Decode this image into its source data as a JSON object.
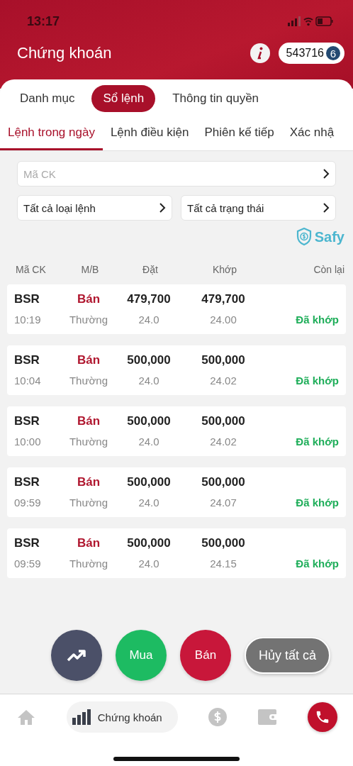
{
  "status_bar": {
    "time": "13:17"
  },
  "header": {
    "title": "Chứng khoán",
    "account": "543716",
    "account_badge": "6"
  },
  "tabs": [
    {
      "label": "Danh mục",
      "selected": false
    },
    {
      "label": "Sổ lệnh",
      "selected": true
    },
    {
      "label": "Thông tin quyền",
      "selected": false
    }
  ],
  "sub_tabs": [
    {
      "label": "Lệnh trong ngày",
      "selected": true
    },
    {
      "label": "Lệnh điều kiện",
      "selected": false
    },
    {
      "label": "Phiên kế tiếp",
      "selected": false
    },
    {
      "label": "Xác nhậ",
      "selected": false
    }
  ],
  "filters": {
    "symbol_placeholder": "Mã CK",
    "order_type": "Tất cả loại lệnh",
    "status": "Tất cả trạng thái"
  },
  "safy_label": "Safy",
  "table": {
    "columns": [
      "Mã CK",
      "M/B",
      "Đặt",
      "Khớp",
      "Còn lại"
    ],
    "rows": [
      {
        "kind": "sell",
        "symbol": "BSR",
        "time": "10:19",
        "side": "Bán",
        "type": "Thường",
        "order_qty": "479,700",
        "order_price": "24.0",
        "match_qty": "479,700",
        "match_price": "24.00",
        "status": "Đã khớp",
        "color": "#1fae5a"
      },
      {
        "kind": "sell",
        "symbol": "BSR",
        "time": "10:04",
        "side": "Bán",
        "type": "Thường",
        "order_qty": "500,000",
        "order_price": "24.0",
        "match_qty": "500,000",
        "match_price": "24.02",
        "status": "Đã khớp",
        "color": "#1fae5a"
      },
      {
        "kind": "sell",
        "symbol": "BSR",
        "time": "10:00",
        "side": "Bán",
        "type": "Thường",
        "order_qty": "500,000",
        "order_price": "24.0",
        "match_qty": "500,000",
        "match_price": "24.02",
        "status": "Đã khớp",
        "color": "#1fae5a"
      },
      {
        "kind": "sell",
        "symbol": "BSR",
        "time": "09:59",
        "side": "Bán",
        "type": "Thường",
        "order_qty": "500,000",
        "order_price": "24.0",
        "match_qty": "500,000",
        "match_price": "24.07",
        "status": "Đã khớp",
        "color": "#1fae5a"
      },
      {
        "kind": "sell",
        "symbol": "BSR",
        "time": "09:59",
        "side": "Bán",
        "type": "Thường",
        "order_qty": "500,000",
        "order_price": "24.0",
        "match_qty": "500,000",
        "match_price": "24.15",
        "status": "Đã khớp",
        "color": "#1fae5a"
      }
    ]
  },
  "actions": [
    {
      "kind": "chart"
    },
    {
      "kind": "buy",
      "label": "Mua"
    },
    {
      "kind": "sell",
      "label": "Bán"
    },
    {
      "kind": "cancel",
      "label": "Hủy tất cả"
    }
  ],
  "bottom_nav": [
    {
      "kind": "home",
      "selected": false
    },
    {
      "kind": "market",
      "label": "Chứng khoán",
      "selected": true
    },
    {
      "kind": "money",
      "selected": false
    },
    {
      "kind": "wallet",
      "selected": false
    },
    {
      "kind": "call",
      "selected": false
    }
  ]
}
